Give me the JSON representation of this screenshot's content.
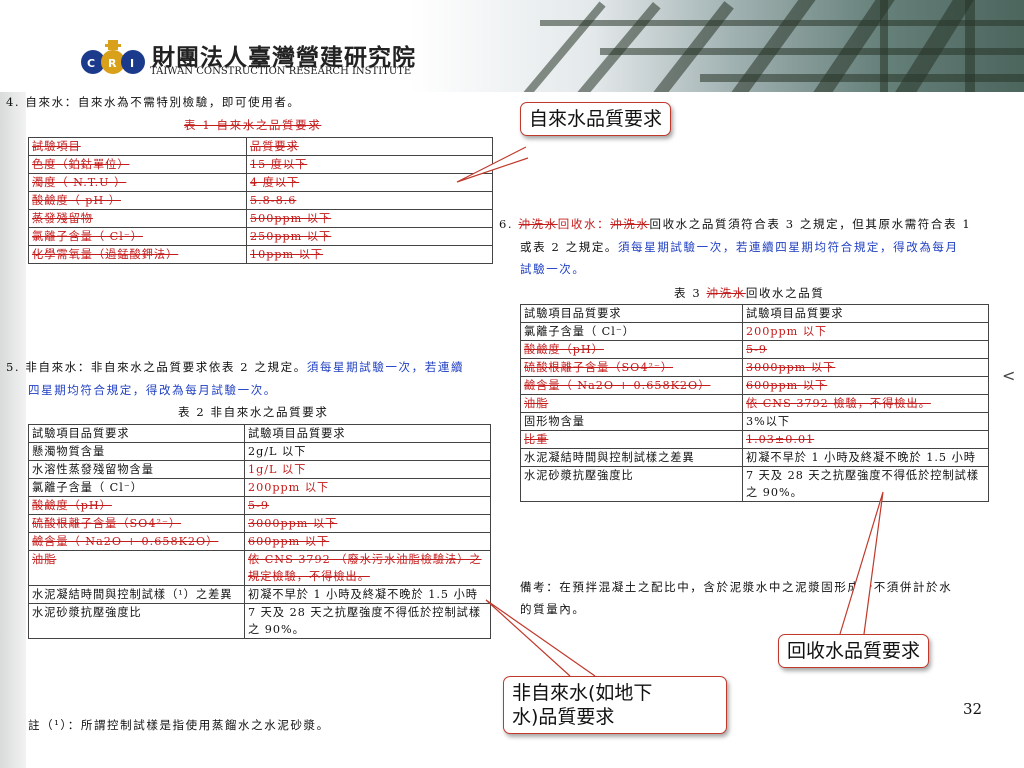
{
  "header": {
    "org_cn": "財團法人臺灣營建研究院",
    "org_en": "TAIWAN CONSTRUCTION RESEARCH INSTITUTE",
    "logo_text": "CRI"
  },
  "sec4": {
    "line": "4. 自來水：自來水為不需特別檢驗，即可使用者。",
    "caption": "表 1  自來水之品質要求",
    "header": [
      "試驗項目",
      "品質要求"
    ],
    "rows": [
      [
        "色度（鉑鈷單位）",
        "15 度以下"
      ],
      [
        "濁度（ N.T.U ）",
        "4 度以下"
      ],
      [
        "酸鹼度（ pH ）",
        "5.8-8.6"
      ],
      [
        "蒸發殘留物",
        "500ppm 以下"
      ],
      [
        "氯離子含量（ Cl⁻）",
        "250ppm 以下"
      ],
      [
        "化學需氧量（過錳酸鉀法）",
        "10ppm 以下"
      ]
    ]
  },
  "sec5": {
    "line1_black": "5. 非自來水：非自來水之品質要求依表 2 之規定。",
    "line1_blue": "須每星期試驗一次，若連續",
    "line2_blue": "四星期均符合規定，得改為每月試驗一次。",
    "caption": "表 2  非自來水之品質要求",
    "header": [
      "試驗項目品質要求",
      "試驗項目品質要求"
    ],
    "rows": [
      [
        "懸濁物質含量",
        "2g/L 以下"
      ],
      [
        "水溶性蒸發殘留物含量",
        "1g/L 以下"
      ],
      [
        "氯離子含量（ Cl⁻）",
        "200ppm 以下"
      ],
      [
        "酸鹼度（pH）",
        "5-9"
      ],
      [
        "硫酸根離子含量（SO4²⁻）",
        "3000ppm 以下"
      ],
      [
        "鹼含量（ Na2O + 0.658K2O）",
        "600ppm 以下"
      ],
      [
        "油脂",
        "依 CNS 3792 （廢水污水油脂檢驗法）之規定檢驗，不得檢出。"
      ],
      [
        "水泥凝結時間與控制試樣（¹）之差異",
        "初凝不早於 1 小時及終凝不晚於 1.5 小時"
      ],
      [
        "水泥砂漿抗壓強度比",
        "7 天及 28 天之抗壓強度不得低於控制試樣之 90%。"
      ]
    ],
    "note": "註（¹）：所謂控制試樣是指使用蒸餾水之水泥砂漿。"
  },
  "sec6": {
    "num": "6.",
    "strike1": "沖洗水",
    "mid1": "回收水：",
    "strike2": "沖洗水",
    "rest1": "回收水之品質須符合表 3 之規定，但其原水需符合表 1",
    "line2_black": "或表 2 之規定。",
    "line2_blue": "須每星期試驗一次，若連續四星期均符合規定，得改為每月",
    "line3_blue": "試驗一次。",
    "caption_pre": "表 3  ",
    "caption_strike": "沖洗水",
    "caption_post": "回收水之品質",
    "header": [
      "試驗項目品質要求",
      "試驗項目品質要求"
    ],
    "rows": [
      [
        "氯離子含量（ Cl⁻）",
        "200ppm 以下"
      ],
      [
        "酸鹼度（pH）",
        "5-9"
      ],
      [
        "硫酸根離子含量（SO4²⁻）",
        "3000ppm 以下"
      ],
      [
        "鹼含量（ Na2O + 0.658K2O）",
        "600ppm 以下"
      ],
      [
        "油脂",
        "依 CNS 3792 檢驗，不得檢出。"
      ],
      [
        "固形物含量",
        "3%以下"
      ],
      [
        "比重",
        "1.03±0.01"
      ],
      [
        "水泥凝結時間與控制試樣之差異",
        "初凝不早於 1 小時及終凝不晚於 1.5 小時"
      ],
      [
        "水泥砂漿抗壓強度比",
        "7 天及 28 天之抗壓強度不得低於控制試樣之 90%。"
      ]
    ],
    "remark1": "備考：在預拌混凝土之配比中，含於泥漿水中之泥漿固形成份不須併計於水",
    "remark2": "的質量內。"
  },
  "callouts": {
    "tap_water": "自來水品質要求",
    "recycled": "回收水品質要求",
    "non_tap_line1": "非自來水(如地下",
    "non_tap_line2": "水)品質要求"
  },
  "page_number": "32",
  "edge_mark": "<",
  "colors": {
    "blue_text": "#1f3fc2",
    "red_text": "#c41b1b",
    "callout_border": "#c0392b"
  }
}
